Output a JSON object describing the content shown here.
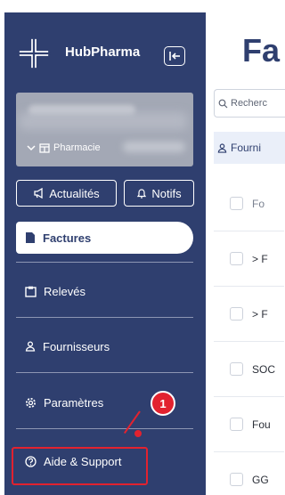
{
  "brand": {
    "name": "HubPharma"
  },
  "pharmacy": {
    "label": "Pharmacie"
  },
  "quick_buttons": {
    "news": "Actualités",
    "notifs": "Notifs"
  },
  "nav": {
    "items": [
      {
        "label": "Factures",
        "icon": "document-icon",
        "active": true
      },
      {
        "label": "Relevés",
        "icon": "clipboard-icon"
      },
      {
        "label": "Fournisseurs",
        "icon": "user-icon"
      },
      {
        "label": "Paramètres",
        "icon": "gear-icon"
      },
      {
        "label": "Aide & Support",
        "icon": "help-icon"
      }
    ]
  },
  "annotation": {
    "step": "1"
  },
  "main": {
    "title": "Fa",
    "search_placeholder": "Recherc",
    "tab_label": "Fourni",
    "table": {
      "header": "Fo",
      "rows": [
        "> F",
        "> F",
        "SOC",
        "Fou",
        "GG"
      ]
    }
  },
  "colors": {
    "sidebar": "#2f3f6f",
    "accent": "#e2222f"
  }
}
